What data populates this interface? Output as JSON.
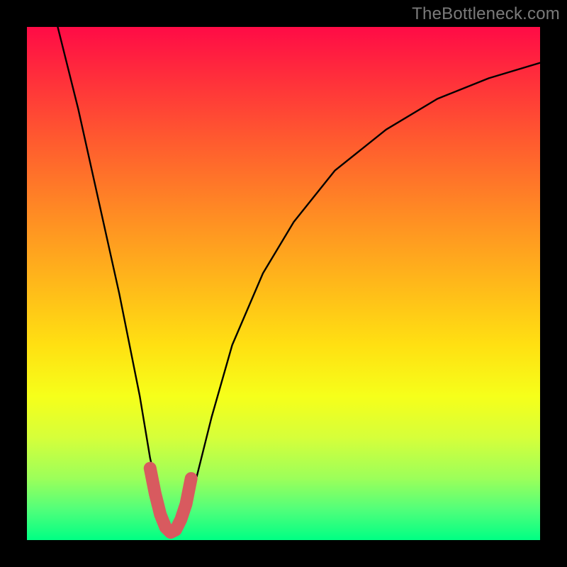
{
  "watermark": "TheBottleneck.com",
  "chart_data": {
    "type": "line",
    "title": "",
    "xlabel": "",
    "ylabel": "",
    "xlim": [
      0,
      100
    ],
    "ylim": [
      0,
      100
    ],
    "grid": false,
    "legend": false,
    "series": [
      {
        "name": "bottleneck-curve",
        "x": [
          6,
          10,
          14,
          18,
          22,
          24,
          26,
          27,
          28,
          29,
          30,
          31,
          33,
          36,
          40,
          46,
          52,
          60,
          70,
          80,
          90,
          100
        ],
        "y": [
          100,
          84,
          66,
          48,
          28,
          16,
          7,
          3,
          1,
          1,
          2,
          5,
          12,
          24,
          38,
          52,
          62,
          72,
          80,
          86,
          90,
          93
        ]
      },
      {
        "name": "highlight-segment",
        "x": [
          24,
          25,
          26,
          27,
          28,
          29,
          30,
          31,
          32
        ],
        "y": [
          14,
          9,
          5,
          2.5,
          1.5,
          2,
          4,
          7,
          12
        ]
      }
    ]
  }
}
